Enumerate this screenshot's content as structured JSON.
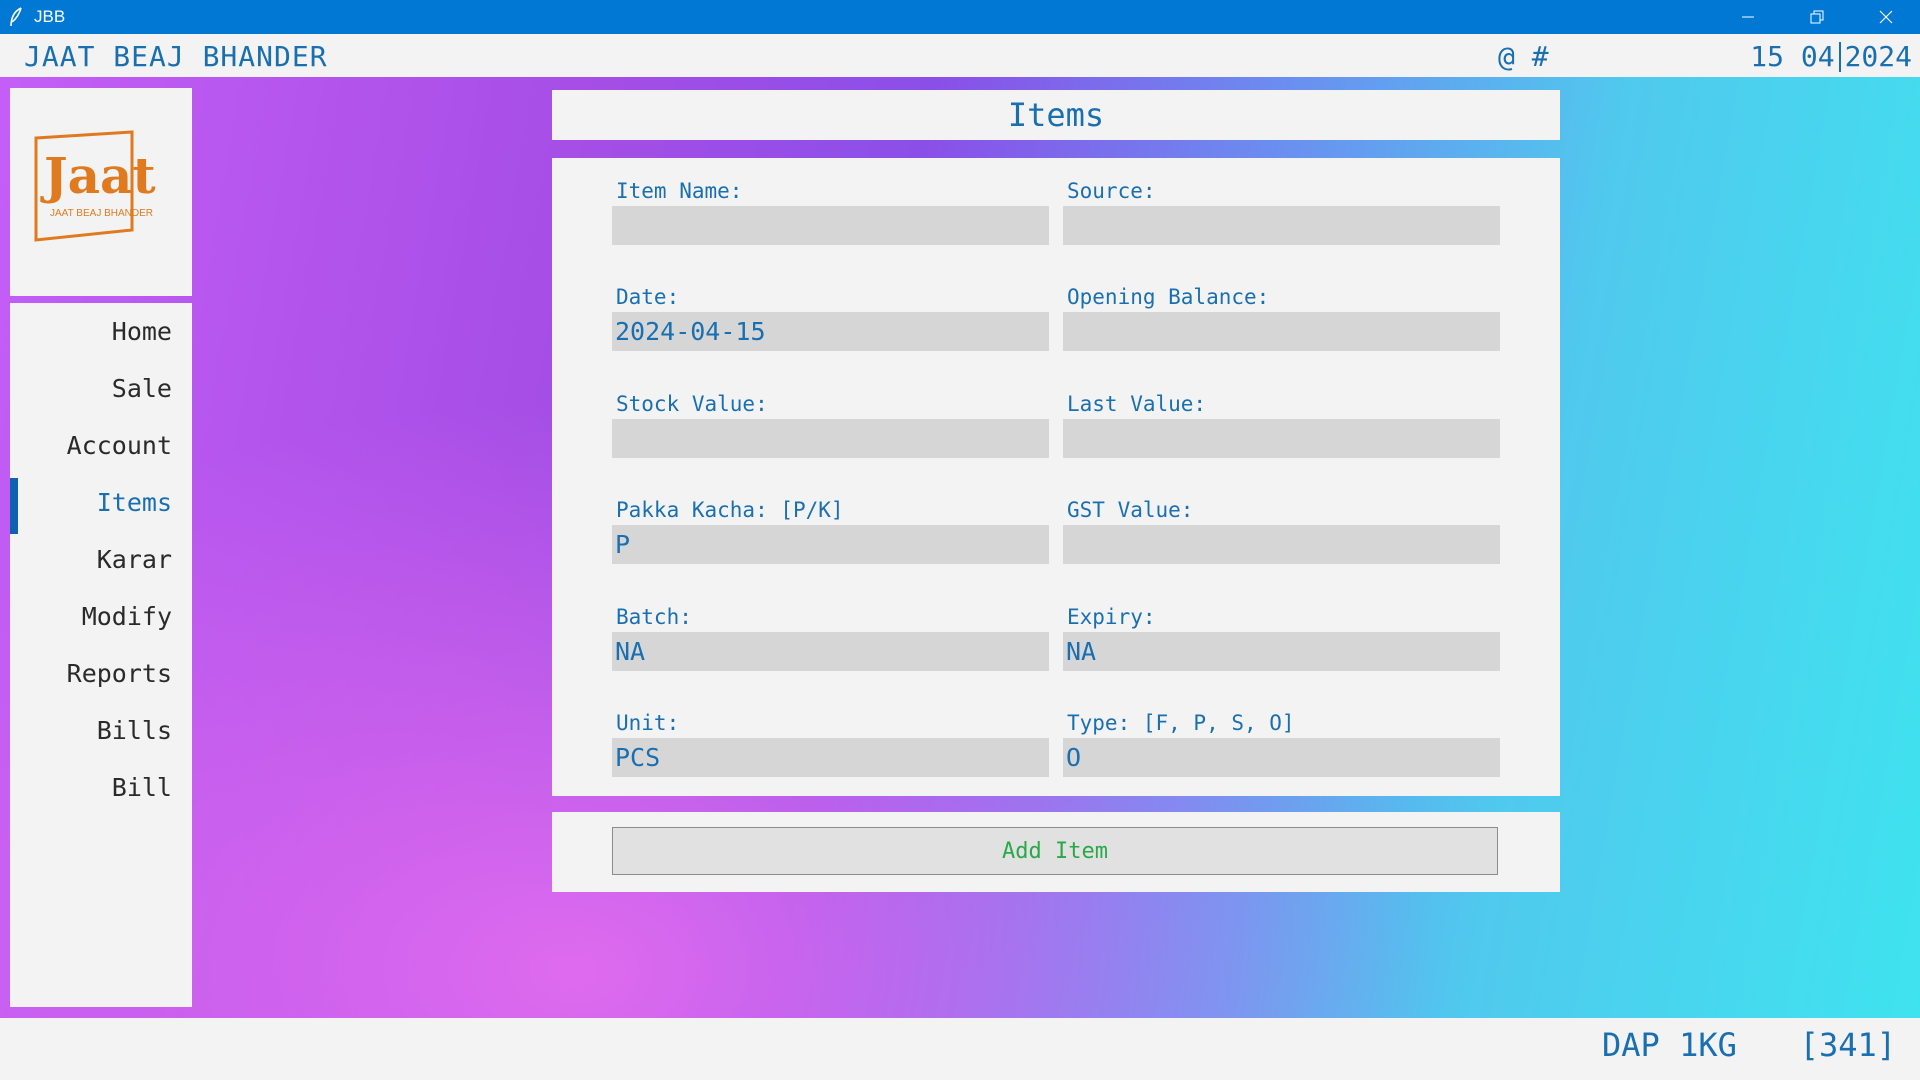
{
  "window": {
    "title": "JBB",
    "icons": {
      "app": "feather-icon",
      "minimize": "minimize-icon",
      "restore": "restore-icon",
      "close": "close-icon"
    }
  },
  "header": {
    "brand": "JAAT BEAJ BHANDER",
    "symbols": "@ #",
    "date_day_month": "15 04",
    "date_year": "2024"
  },
  "logo": {
    "word": "Jaat",
    "sub": "JAAT BEAJ BHANDER"
  },
  "sidebar": {
    "items": [
      {
        "label": "Home"
      },
      {
        "label": "Sale"
      },
      {
        "label": "Account"
      },
      {
        "label": "Items",
        "active": true
      },
      {
        "label": "Karar"
      },
      {
        "label": "Modify"
      },
      {
        "label": "Reports"
      },
      {
        "label": "Bills"
      },
      {
        "label": "Bill"
      }
    ]
  },
  "page": {
    "title": "Items"
  },
  "form": {
    "item_name": {
      "label": "Item Name:",
      "value": ""
    },
    "source": {
      "label": "Source:",
      "value": ""
    },
    "date": {
      "label": "Date:",
      "value": "2024-04-15"
    },
    "opening_balance": {
      "label": "Opening Balance:",
      "value": ""
    },
    "stock_value": {
      "label": "Stock Value:",
      "value": ""
    },
    "last_value": {
      "label": "Last Value:",
      "value": ""
    },
    "pakka_kacha": {
      "label": "Pakka Kacha: [P/K]",
      "value": "P"
    },
    "gst_value": {
      "label": "GST Value:",
      "value": ""
    },
    "batch": {
      "label": "Batch:",
      "value": "NA"
    },
    "expiry": {
      "label": "Expiry:",
      "value": "NA"
    },
    "unit": {
      "label": "Unit:",
      "value": "PCS"
    },
    "type": {
      "label": "Type: [F, P, S, O]",
      "value": "O"
    }
  },
  "actions": {
    "add_item": "Add Item"
  },
  "status": {
    "item_name": "DAP 1KG",
    "count": "[341]"
  },
  "colors": {
    "titlebar": "#0078d4",
    "accent_text": "#1a6fb0",
    "logo": "#e07a1f",
    "add_button_text": "#2aa84a"
  }
}
